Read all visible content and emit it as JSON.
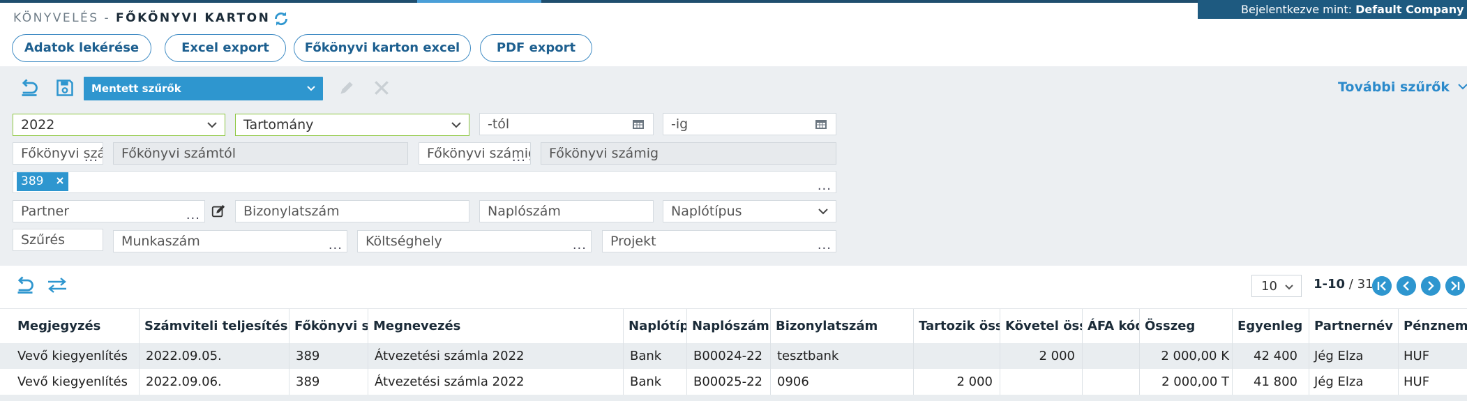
{
  "user": {
    "prefix": "Bejelentkezve mint:",
    "company": "Default Company"
  },
  "breadcrumb": {
    "module": "KÖNYVELÉS -",
    "page": "FŐKÖNYVI KARTON"
  },
  "top_buttons": {
    "fetch": "Adatok lekérése",
    "excel": "Excel export",
    "ledger_excel": "Főkönyvi karton excel",
    "pdf": "PDF export"
  },
  "filters": {
    "saved": "Mentett szűrők",
    "more": "További szűrők",
    "year": "2022",
    "range": "Tartomány",
    "from_date": "-tól",
    "to_date": "-ig",
    "account_from_label": "Főkönyvi szá",
    "account_from": "Főkönyvi számtól",
    "account_to_label": "Főkönyvi számig",
    "account_to": "Főkönyvi számig",
    "tag": "389",
    "partner": "Partner",
    "document_no": "Bizonylatszám",
    "journal_no": "Naplószám",
    "journal_type": "Naplótípus",
    "filter_label": "Szűrés",
    "job_no": "Munkaszám",
    "cost_center": "Költséghely",
    "project": "Projekt"
  },
  "pager": {
    "page_size": "10",
    "range": "1-10",
    "total": "/ 31"
  },
  "table": {
    "columns": [
      "Megjegyzés",
      "Számviteli teljesítés dátuma",
      "Főkönyvi szám",
      "Megnevezés",
      "Naplótípus",
      "Naplószám",
      "Bizonylatszám",
      "Tartozik összeg",
      "Követel összeg",
      "ÁFA kód",
      "Összeg",
      "Egyenleg",
      "Partnernév",
      "Pénznem"
    ],
    "rows": [
      [
        "Vevő kiegyenlítés",
        "2022.09.05.",
        "389",
        "Átvezetési számla 2022",
        "Bank",
        "B00024-22",
        "tesztbank",
        "",
        "2 000",
        "",
        "2 000,00 K",
        "42 400",
        "Jég Elza",
        "HUF"
      ],
      [
        "Vevő kiegyenlítés",
        "2022.09.06.",
        "389",
        "Átvezetési számla 2022",
        "Bank",
        "B00025-22",
        "0906",
        "2 000",
        "",
        "",
        "2 000,00 T",
        "41 800",
        "Jég Elza",
        "HUF"
      ]
    ]
  },
  "colors": {
    "accent": "#2e96cf",
    "dark": "#1e5a80",
    "green_border": "#8cc63f"
  }
}
